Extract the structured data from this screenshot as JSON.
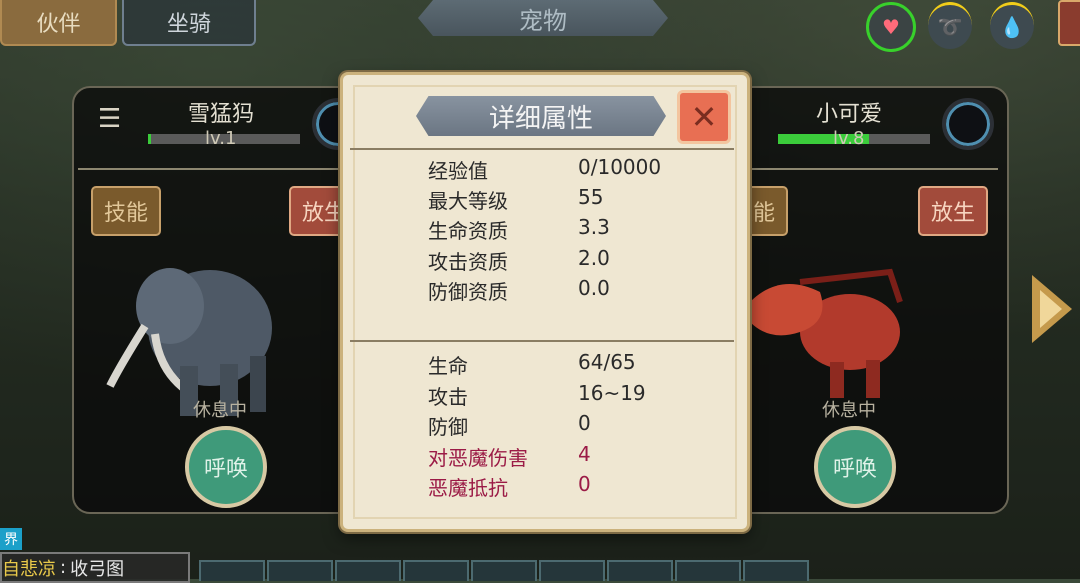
{
  "top_tabs": {
    "partner": "伙伴",
    "mount": "坐骑",
    "title": "宠物"
  },
  "top_icons": [
    "heart-icon",
    "beast-icon",
    "water-drop-icon"
  ],
  "left_pet": {
    "name": "雪猛犸",
    "level": "lv.1",
    "level_progress": 0.02,
    "skill_btn": "技能",
    "release_btn": "放生",
    "status": "休息中",
    "summon_btn": "呼唤"
  },
  "right_pet": {
    "name": "小可爱",
    "level": "lv.8",
    "level_progress": 0.6,
    "skill_btn": "技能",
    "release_btn": "放生",
    "status": "休息中",
    "summon_btn": "呼唤"
  },
  "modal": {
    "title": "详细属性",
    "close": "✕",
    "section1": [
      {
        "label": "经验值",
        "value": "0/10000"
      },
      {
        "label": "最大等级",
        "value": "55"
      },
      {
        "label": "生命资质",
        "value": "3.3"
      },
      {
        "label": "攻击资质",
        "value": "2.0"
      },
      {
        "label": "防御资质",
        "value": "0.0"
      }
    ],
    "section2": [
      {
        "label": "生命",
        "value": "64/65"
      },
      {
        "label": "攻击",
        "value": "16~19"
      },
      {
        "label": "防御",
        "value": "0"
      },
      {
        "label": "对恶魔伤害",
        "value": "4"
      },
      {
        "label": "恶魔抵抗",
        "value": "0"
      }
    ]
  },
  "chat": {
    "channel": "界",
    "name": "自悲凉",
    "sep": ":",
    "text": "收弓图"
  },
  "colors": {
    "accent_green": "#3bcc3b",
    "release_red": "#a24b3b",
    "special_stat": "#9b1b46"
  }
}
